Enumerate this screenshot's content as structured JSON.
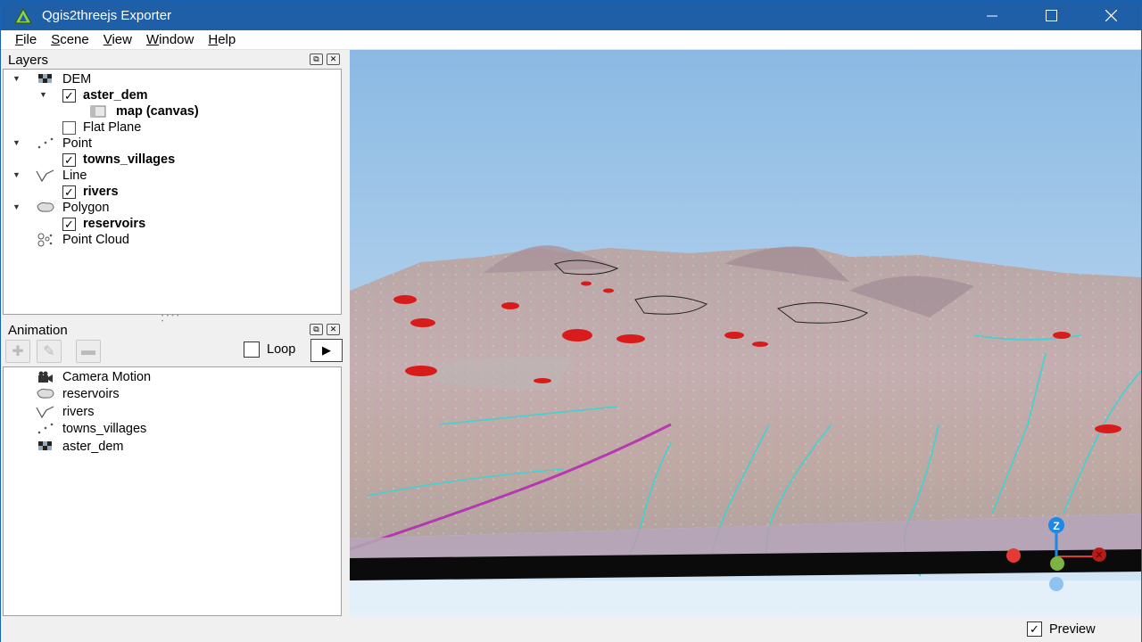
{
  "window": {
    "title": "Qgis2threejs Exporter",
    "accent": "#1e5fa8",
    "controls": {
      "minimize_icon": "minimize-icon",
      "maximize_icon": "maximize-icon",
      "close_icon": "close-icon"
    }
  },
  "menu": {
    "items": [
      {
        "key": "F",
        "rest": "ile"
      },
      {
        "key": "S",
        "rest": "cene"
      },
      {
        "key": "V",
        "rest": "iew"
      },
      {
        "key": "W",
        "rest": "indow"
      },
      {
        "key": "H",
        "rest": "elp"
      }
    ]
  },
  "layers_panel": {
    "title": "Layers",
    "items": {
      "dem": "DEM",
      "aster_dem": "aster_dem",
      "map_canvas": "map (canvas)",
      "flat_plane": "Flat Plane",
      "point": "Point",
      "towns_villages": "towns_villages",
      "line": "Line",
      "rivers": "rivers",
      "polygon": "Polygon",
      "reservoirs": "reservoirs",
      "point_cloud": "Point Cloud"
    }
  },
  "animation_panel": {
    "title": "Animation",
    "loop_label": "Loop",
    "play_icon": "play-icon",
    "items": {
      "camera_motion": "Camera Motion",
      "reservoirs": "reservoirs",
      "rivers": "rivers",
      "towns_villages": "towns_villages",
      "aster_dem": "aster_dem"
    }
  },
  "viewport": {
    "sky_top": "#8bb9e3",
    "sky_bottom": "#cfe3f4",
    "marker_color": "#d81b1b",
    "river_color": "#33d6d6",
    "axis": {
      "z_label": "Z"
    }
  },
  "status": {
    "preview_label": "Preview",
    "preview_checked": true
  }
}
